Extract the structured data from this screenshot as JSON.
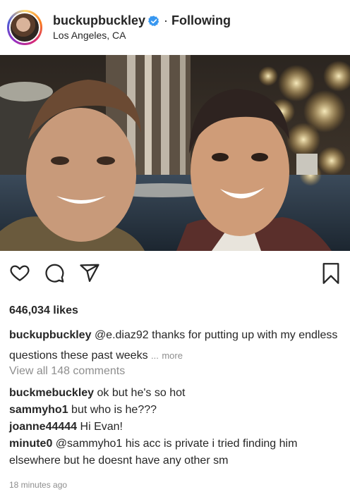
{
  "header": {
    "username": "buckupbuckley",
    "separator": "·",
    "following_label": "Following",
    "location": "Los Angeles, CA",
    "verified_color": "#3897f0"
  },
  "actions": {
    "icons": [
      "heart-icon",
      "comment-icon",
      "share-icon",
      "bookmark-icon"
    ]
  },
  "post": {
    "likes": "646,034 likes",
    "caption": {
      "user": "buckupbuckley",
      "text": "@e.diaz92 thanks for putting up with my endless questions these past weeks",
      "ellipsis": "...",
      "more_label": "more"
    },
    "view_all": "View all 148 comments",
    "comments": [
      {
        "user": "buckmebuckley",
        "text": "ok but he's so hot"
      },
      {
        "user": "sammyho1",
        "text": "but who is he???"
      },
      {
        "user": "joanne44444",
        "text": "Hi Evan!"
      },
      {
        "user": "minute0",
        "text": "@sammyho1 his acc is private i tried finding him elsewhere but he doesnt have any other sm"
      }
    ],
    "timestamp": "18 minutes ago"
  }
}
